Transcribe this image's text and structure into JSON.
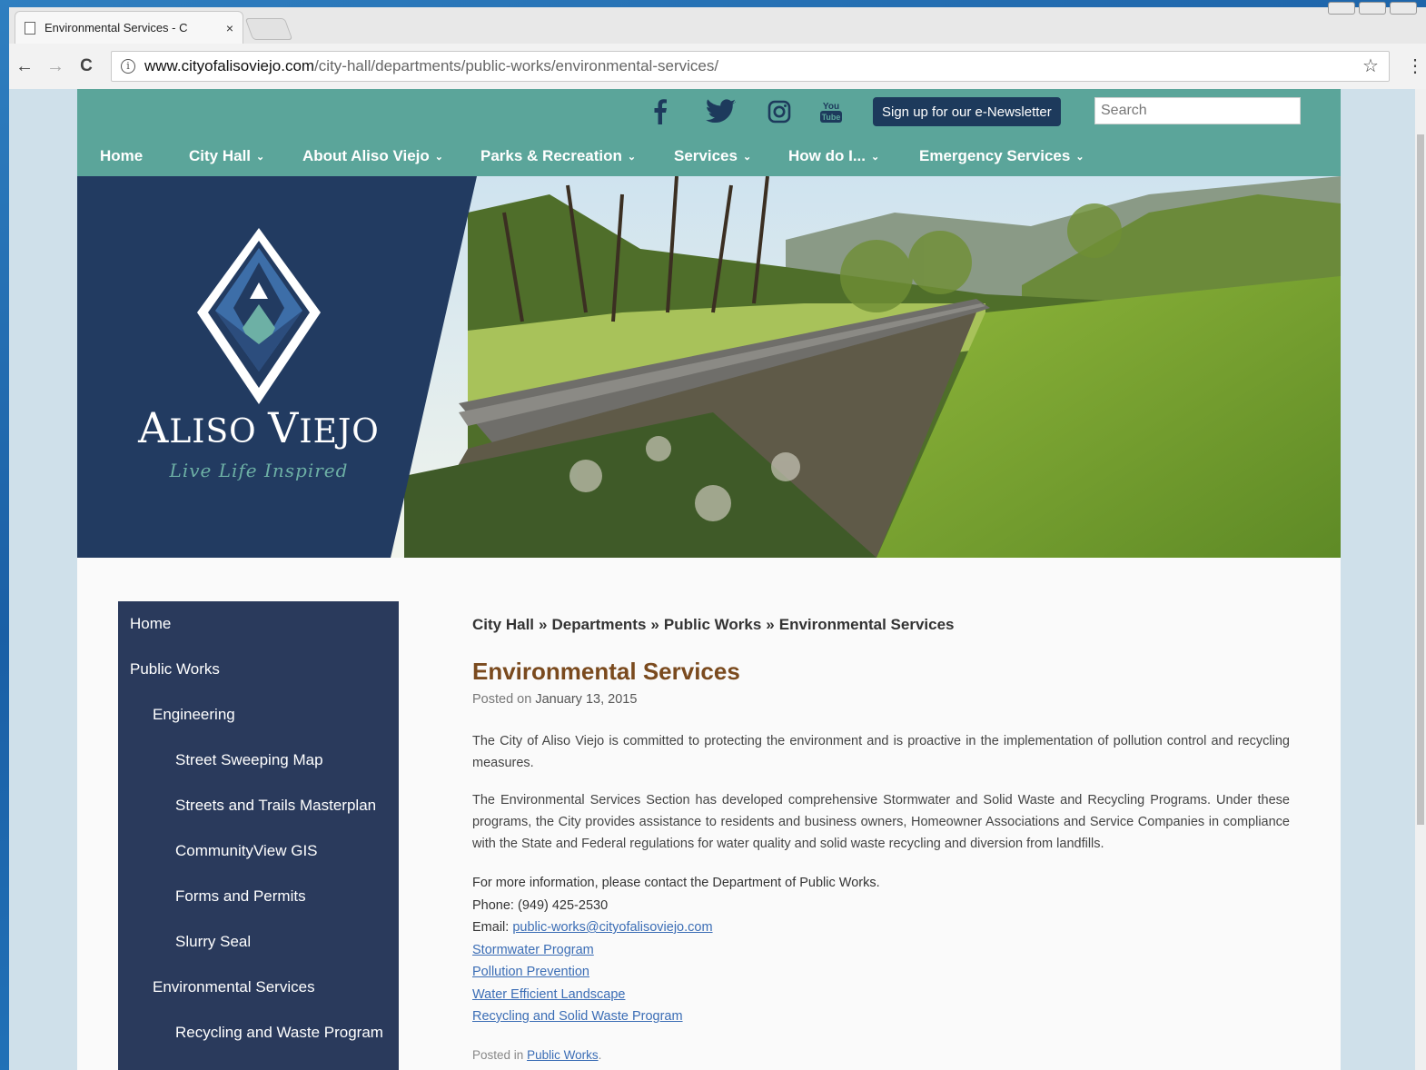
{
  "browser": {
    "tab_title": "Environmental Services - C",
    "tab_close": "×",
    "url_host": "www.cityofalisoviejo.com",
    "url_path": "/city-hall/departments/public-works/environmental-services/",
    "back": "←",
    "forward": "→",
    "reload": "C",
    "star": "☆",
    "menu": "⋮"
  },
  "topbar": {
    "social": [
      "facebook-icon",
      "twitter-icon",
      "instagram-icon",
      "youtube-icon"
    ],
    "newsletter_label": "Sign up for our e-Newsletter",
    "search_placeholder": "Search"
  },
  "nav": {
    "items": [
      {
        "label": "Home",
        "has_caret": false
      },
      {
        "label": "City Hall",
        "has_caret": true
      },
      {
        "label": "About Aliso Viejo",
        "has_caret": true
      },
      {
        "label": "Parks & Recreation",
        "has_caret": true
      },
      {
        "label": "Services",
        "has_caret": true
      },
      {
        "label": "How do I...",
        "has_caret": true
      },
      {
        "label": "Emergency Services",
        "has_caret": true
      }
    ],
    "caret": "⌄"
  },
  "logo": {
    "name_first": "A",
    "name_rest": "LISO ",
    "name_second": "V",
    "name_rest2": "IEJO",
    "tagline": "Live Life Inspired"
  },
  "sidebar": {
    "items": [
      {
        "label": "Home",
        "level": 0
      },
      {
        "label": "Public Works",
        "level": 0
      },
      {
        "label": "Engineering",
        "level": 1
      },
      {
        "label": "Street Sweeping Map",
        "level": 2
      },
      {
        "label": "Streets and Trails Masterplan",
        "level": 2
      },
      {
        "label": "CommunityView GIS",
        "level": 2
      },
      {
        "label": "Forms and Permits",
        "level": 2
      },
      {
        "label": "Slurry Seal",
        "level": 2
      },
      {
        "label": "Environmental Services",
        "level": 1
      },
      {
        "label": "Recycling and Waste Program",
        "level": 2
      }
    ]
  },
  "breadcrumb": {
    "items": [
      "City Hall",
      "Departments",
      "Public Works",
      "Environmental Services"
    ],
    "separator": "»"
  },
  "article": {
    "title": "Environmental Services",
    "posted_prefix": "Posted on",
    "posted_date": "January 13, 2015",
    "paragraph1": "The City of Aliso Viejo is committed to protecting the environment and is proactive in the implementation of pollution control and recycling measures.",
    "paragraph2": "The Environmental Services Section has developed comprehensive Stormwater and Solid Waste and Recycling Programs. Under these programs, the City provides assistance to residents and business owners, Homeowner Associations and Service Companies in compliance with the State and Federal regulations for water quality and solid waste recycling and diversion from landfills.",
    "contact_intro": "For more information, please contact the Department of Public Works.",
    "phone": "Phone: (949) 425-2530",
    "email_label": "Email:",
    "email": "public-works@cityofalisoviejo.com",
    "links": [
      "Stormwater Program",
      "Pollution Prevention",
      "Water Efficient Landscape",
      "Recycling and Solid Waste Program"
    ],
    "filed_prefix": "Posted in",
    "filed_category": "Public Works",
    "filed_suffix": "."
  }
}
